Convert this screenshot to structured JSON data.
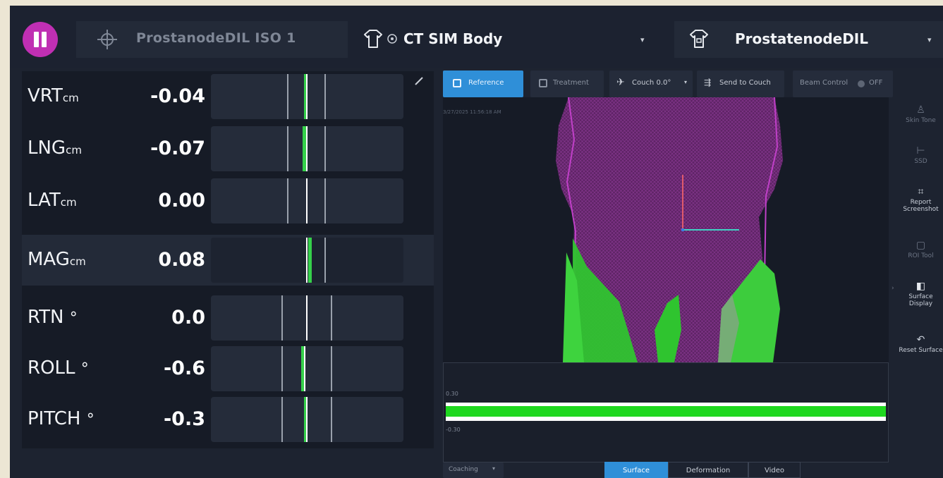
{
  "topbar": {
    "pause_icon": "pause-icon",
    "iso_icon": "crosshair-icon",
    "iso_label": "ProstanodeDIL ISO 1",
    "body_icon": "body-outline-icon",
    "body_status_icon": "circle-check-icon",
    "body_label": "CT SIM Body",
    "target_icon": "body-target-icon",
    "target_label": "ProstatenodeDIL",
    "accent_color": "#c02fb3"
  },
  "metrics": [
    {
      "name": "VRT",
      "unit": "cm",
      "value": "-0.04",
      "offset": -0.04
    },
    {
      "name": "LNG",
      "unit": "cm",
      "value": "-0.07",
      "offset": -0.07
    },
    {
      "name": "LAT",
      "unit": "cm",
      "value": "0.00",
      "offset": 0.0
    },
    {
      "name": "MAG",
      "unit": "cm",
      "value": "0.08",
      "offset": 0.08
    },
    {
      "name": "RTN",
      "unit": "°",
      "value": "0.0",
      "offset": 0.0
    },
    {
      "name": "ROLL",
      "unit": "°",
      "value": "-0.6",
      "offset": -0.6
    },
    {
      "name": "PITCH",
      "unit": "°",
      "value": "-0.3",
      "offset": -0.3
    }
  ],
  "viewer": {
    "reference_label": "Reference",
    "treatment_label": "Treatment",
    "couch_label": "Couch 0.0°",
    "send_label": "Send to Couch",
    "beam_label": "Beam Control",
    "beam_state": "OFF",
    "timestamp": "3/27/2025 11:56:18 AM",
    "graph_upper": "0.30",
    "graph_lower": "-0.30"
  },
  "side_tools": [
    {
      "label": "Skin Tone",
      "icon": "person-icon",
      "enabled": false
    },
    {
      "label": "SSD",
      "icon": "ruler-icon",
      "enabled": false
    },
    {
      "label": "Report Screenshot",
      "icon": "screenshot-icon",
      "enabled": true
    },
    {
      "label": "ROI Tool",
      "icon": "roi-icon",
      "enabled": false
    },
    {
      "label": "Surface Display",
      "icon": "surface-icon",
      "enabled": true
    },
    {
      "label": "Reset Surface",
      "icon": "reset-icon",
      "enabled": true
    }
  ],
  "bottom": {
    "coaching_label": "Coaching",
    "tabs": [
      "Surface",
      "Deformation",
      "Video"
    ]
  },
  "colors": {
    "green": "#35d04a",
    "active_blue": "#2f8fd8",
    "mesh_magenta": "#7a2a82",
    "mesh_green": "#2dbb2d"
  }
}
